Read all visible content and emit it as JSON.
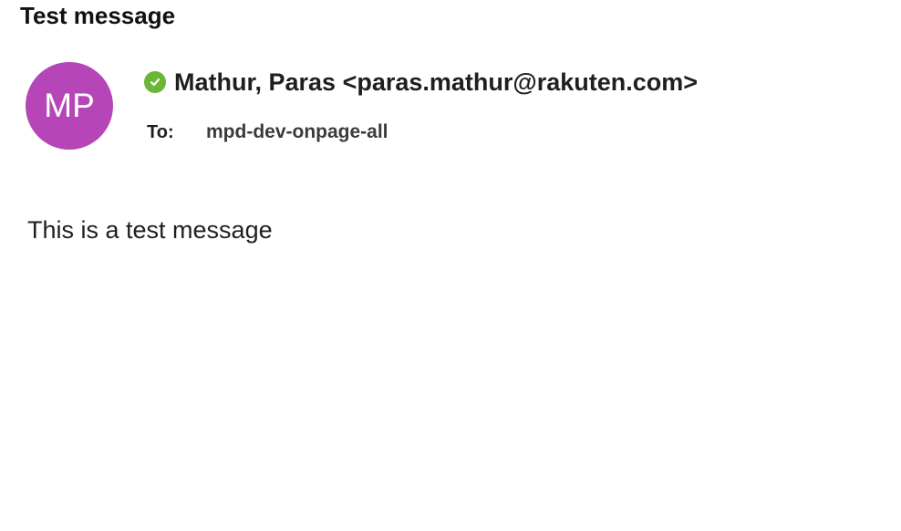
{
  "message": {
    "subject": "Test message",
    "sender": {
      "initials": "MP",
      "display": "Mathur, Paras <paras.mathur@rakuten.com>",
      "avatar_color": "#b646b8",
      "presence_icon": "check-circle-icon",
      "presence_color": "#6bb637"
    },
    "to": {
      "label": "To:",
      "value": "mpd-dev-onpage-all"
    },
    "body": "This is a test message"
  }
}
